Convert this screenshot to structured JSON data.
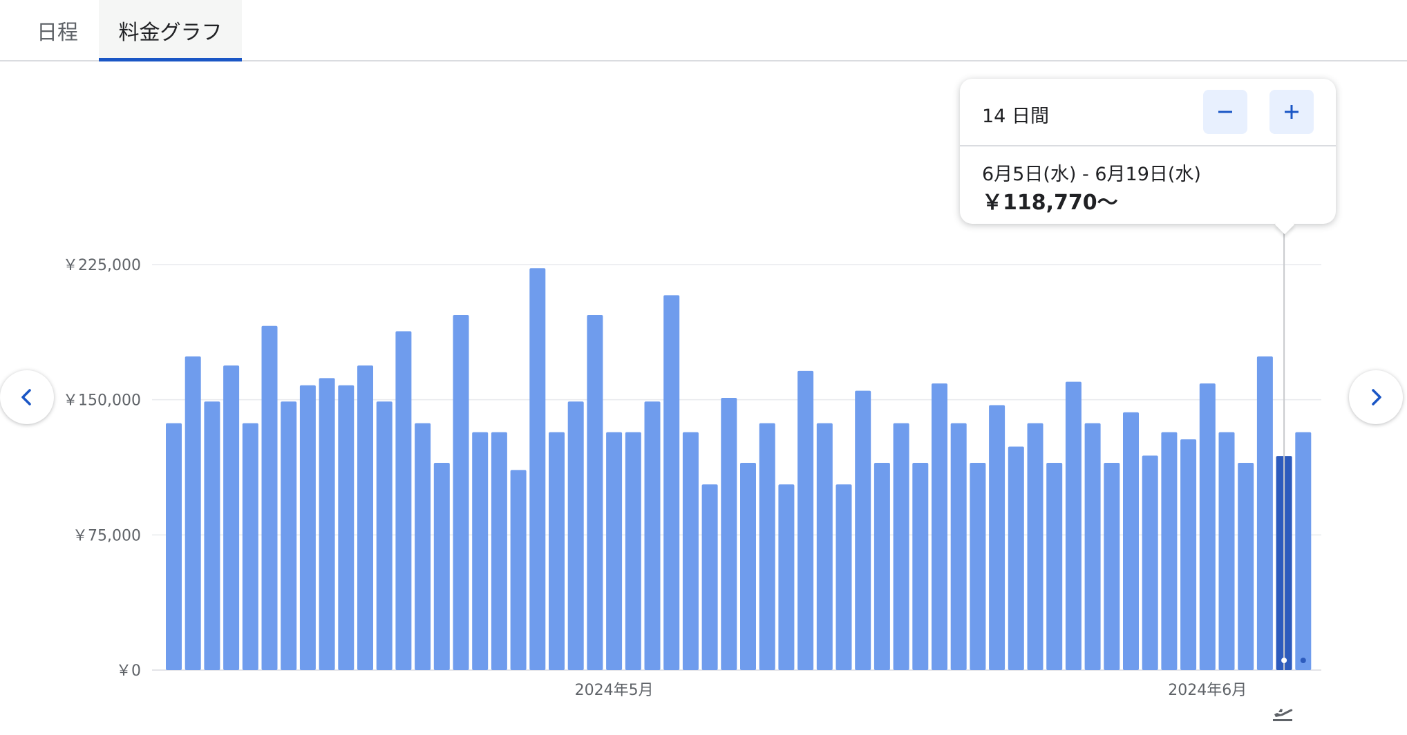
{
  "tabs": [
    {
      "label": "日程"
    },
    {
      "label": "料金グラフ",
      "active": true
    }
  ],
  "tooltip": {
    "duration": "14 日間",
    "dates": "6月5日(水) - 6月19日(水)",
    "price": "￥118,770～"
  },
  "icons": {
    "prev": "chevron-left-icon",
    "next": "chevron-right-icon",
    "minus": "minus-icon",
    "plus": "plus-icon",
    "departure": "flight-departure-icon"
  },
  "colors": {
    "bar": "#6f9ced",
    "bar_selected": "#2d5bbd",
    "accent": "#1a56c5",
    "grid": "#e8eaed",
    "axis_text": "#5f6368"
  },
  "chart_data": {
    "type": "bar",
    "ylim": [
      0,
      225000
    ],
    "y_ticks": [
      {
        "value": 0,
        "label": "￥0"
      },
      {
        "value": 75000,
        "label": "￥75,000"
      },
      {
        "value": 150000,
        "label": "￥150,000"
      },
      {
        "value": 225000,
        "label": "￥225,000"
      }
    ],
    "x_ticks": [
      {
        "index": 23,
        "label": "2024年5月"
      },
      {
        "index": 54,
        "label": "2024年6月"
      }
    ],
    "values": [
      137000,
      174000,
      149000,
      169000,
      137000,
      191000,
      149000,
      158000,
      162000,
      158000,
      169000,
      149000,
      188000,
      137000,
      115000,
      197000,
      132000,
      132000,
      111000,
      223000,
      132000,
      149000,
      197000,
      132000,
      132000,
      149000,
      208000,
      132000,
      103000,
      151000,
      115000,
      137000,
      103000,
      166000,
      137000,
      103000,
      155000,
      115000,
      137000,
      115000,
      159000,
      137000,
      115000,
      147000,
      124000,
      137000,
      115000,
      160000,
      137000,
      115000,
      143000,
      119000,
      132000,
      128000,
      159000,
      132000,
      115000,
      174000,
      118770,
      132000
    ],
    "selected_index": 58,
    "markers": [
      58,
      59
    ],
    "grid": true
  }
}
